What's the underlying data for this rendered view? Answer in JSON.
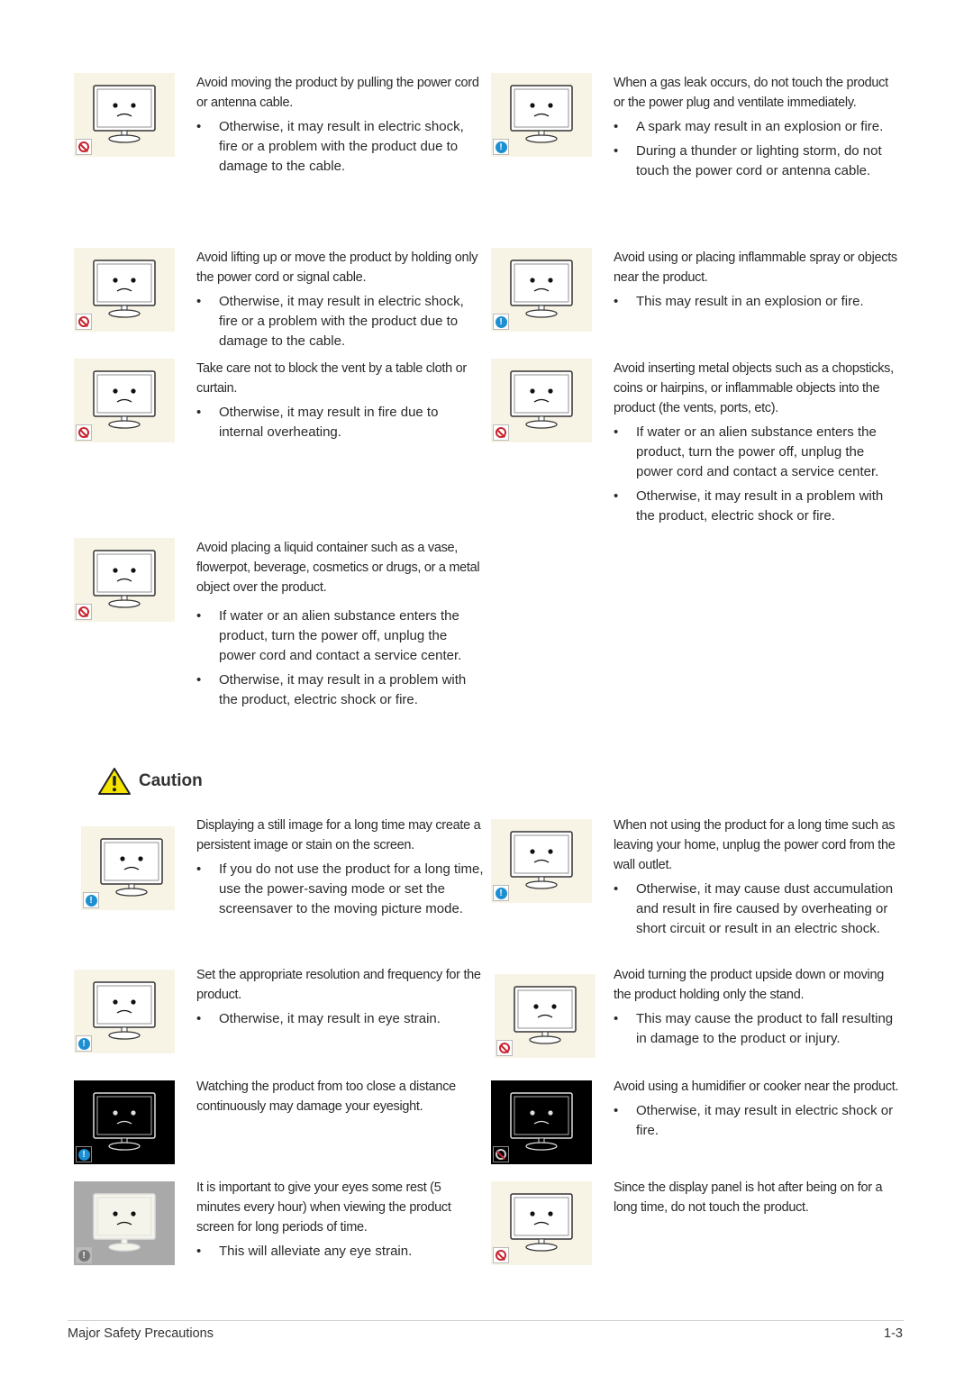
{
  "warnings": [
    {
      "badge": "prohibit-icon",
      "illustration": "monitor-pulled-by-cord",
      "lead": "Avoid moving the product by pulling the power cord or antenna cable.",
      "bullets": [
        "Otherwise, it may result in electric shock, fire or a problem with the product due to damage to the cable."
      ]
    },
    {
      "badge": "info-icon",
      "illustration": "gas-leak-window",
      "lead": "When a gas leak occurs, do not touch the product or the power plug and ventilate immediately.",
      "bullets": [
        "A spark may result in an explosion or fire.",
        "During a thunder or lighting storm, do not touch the power cord or antenna cable."
      ]
    },
    {
      "badge": "prohibit-icon",
      "illustration": "monitor-lifted-by-cables",
      "lead": "Avoid lifting up or move the product by holding only the power cord or signal cable.",
      "bullets": [
        "Otherwise, it may result in electric shock, fire or a problem with the product due to damage to the cable."
      ]
    },
    {
      "badge": "info-icon",
      "illustration": "monitor-inflammable-spray",
      "lead": "Avoid using or placing inflammable spray or objects near the product.",
      "bullets": [
        "This may result in an explosion or fire."
      ]
    },
    {
      "badge": "prohibit-icon",
      "illustration": "monitor-covered-by-cloth",
      "lead": "Take care not to block the vent by a table cloth or curtain.",
      "bullets": [
        "Otherwise, it may result in fire due to internal overheating."
      ]
    },
    {
      "badge": "prohibit-icon",
      "illustration": "monitor-metal-objects",
      "lead": "Avoid inserting metal objects such as a chopsticks, coins or hairpins, or inflammable objects into the product (the vents, ports, etc).",
      "bullets": [
        "If water or an alien substance enters the product, turn the power off, unplug the power cord and contact a service center.",
        "Otherwise, it may result in a problem with the product, electric shock or fire."
      ]
    },
    {
      "badge": "prohibit-icon",
      "illustration": "monitor-liquid-container",
      "lead": "Avoid placing a liquid container such as a vase, flowerpot, beverage, cosmetics or drugs, or a metal object over the product.",
      "bullets": [
        "If water or an alien substance enters the product, turn the power off, unplug the power cord and contact a  service center.",
        "Otherwise, it may result in a problem with the product, electric shock or fire."
      ]
    }
  ],
  "caution": {
    "title": "Caution",
    "icon": "warning-triangle-icon",
    "items": [
      {
        "badge": "info-icon",
        "illustration": "monitor-persistent-image",
        "lead": "Displaying a still image for a long time may create a persistent image or stain on the screen.",
        "bullets": [
          "If you do not use the product for a long time, use the power-saving mode or set the screensaver to the moving picture mode."
        ]
      },
      {
        "badge": "info-icon",
        "illustration": "monitor-sleeping-unplugged",
        "lead": "When not using the product for a long time such as leaving your home, unplug the power cord from the wall outlet.",
        "bullets": [
          "Otherwise, it may cause dust accumulation and result in fire caused by overheating or short circuit or result in an electric shock."
        ]
      },
      {
        "badge": "info-icon",
        "illustration": "monitor-resolution",
        "lead": "Set the appropriate resolution and frequency for the product.",
        "bullets": [
          "Otherwise, it may result in eye strain."
        ]
      },
      {
        "badge": "prohibit-icon",
        "illustration": "monitor-upside-down",
        "lead": "Avoid turning the product upside down or moving the product holding only the stand.",
        "bullets": [
          "This may cause the product to fall resulting in damage to the product or injury."
        ]
      },
      {
        "badge": "info-icon",
        "illustration": "viewer-too-close",
        "lead": "Watching the product from too close a distance continuously may damage your eyesight.",
        "bullets": []
      },
      {
        "badge": "prohibit-icon",
        "illustration": "humidifier-near-monitor",
        "lead": "Avoid using a humidifier or cooker near the product.",
        "bullets": [
          "Otherwise, it may result in electric shock or fire."
        ]
      },
      {
        "badge": "info-icon",
        "illustration": "eyes-rest",
        "lead": "It is important to give your eyes some rest (5 minutes every hour) when viewing the product screen for long periods of time.",
        "bullets": [
          "This will alleviate any eye strain."
        ]
      },
      {
        "badge": "prohibit-icon",
        "illustration": "hot-panel-touch",
        "lead": "Since the display panel is hot after being on for a long time, do not touch the product.",
        "bullets": []
      }
    ]
  },
  "bullet_char": "•",
  "info_glyph": "!",
  "footer": {
    "section": "Major Safety Precautions",
    "page": "1-3"
  },
  "colors": {
    "prohibit": "#c8242f",
    "info": "#1b8fd2",
    "caution_yellow": "#f5e400"
  }
}
